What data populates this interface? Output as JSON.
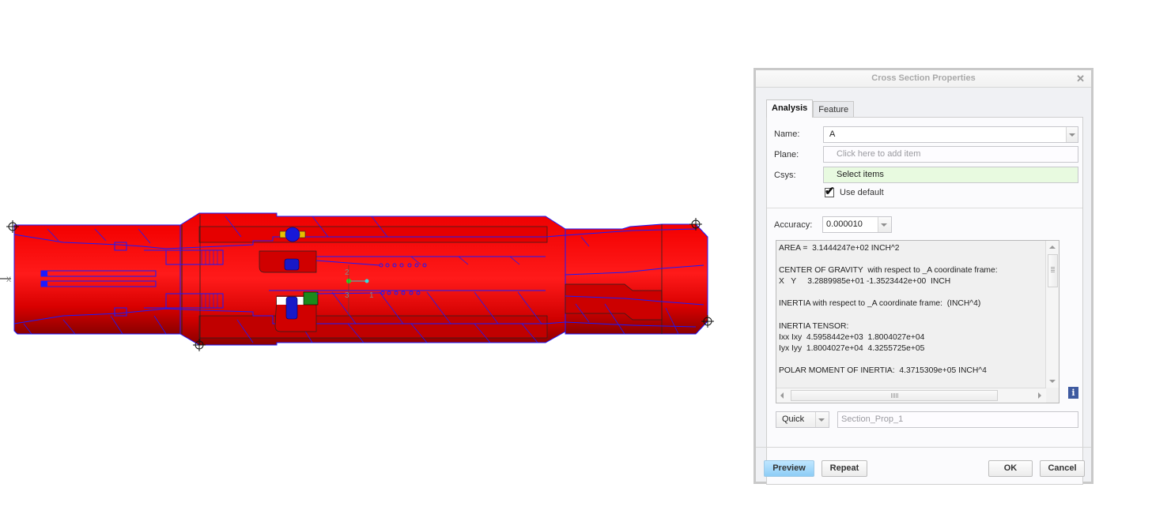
{
  "dialog": {
    "title": "Cross Section Properties",
    "close_icon": "close-icon",
    "tabs": [
      {
        "label": "Analysis",
        "active": true
      },
      {
        "label": "Feature",
        "active": false
      }
    ],
    "name": {
      "label": "Name:",
      "value": "A"
    },
    "plane": {
      "label": "Plane:",
      "placeholder": "Click here to add item"
    },
    "csys": {
      "label": "Csys:",
      "value": "Select items"
    },
    "use_default": {
      "label": "Use default",
      "checked": true
    },
    "accuracy": {
      "label": "Accuracy:",
      "value": "0.000010"
    },
    "results": {
      "lines": [
        "AREA =  3.1444247e+02 INCH^2",
        "",
        "CENTER OF GRAVITY  with respect to _A coordinate frame:",
        "X   Y     3.2889985e+01 -1.3523442e+00  INCH",
        "",
        "INERTIA with respect to _A coordinate frame:  (INCH^4)",
        "",
        "INERTIA TENSOR:",
        "Ixx Ixy  4.5958442e+03  1.8004027e+04",
        "Iyx Iyy  1.8004027e+04  4.3255725e+05",
        "",
        "POLAR MOMENT OF INERTIA:  4.3715309e+05 INCH^4"
      ]
    },
    "info_icon": "info-icon",
    "mode": {
      "value": "Quick"
    },
    "feature_name": {
      "placeholder": "Section_Prop_1"
    },
    "buttons": {
      "preview": "Preview",
      "repeat": "Repeat",
      "ok": "OK",
      "cancel": "Cancel"
    }
  },
  "model": {
    "body_color": "#ff1010",
    "edge_color": "#1a1aff",
    "shade_color": "#a80000",
    "csys_labels": [
      "X",
      "2",
      "3",
      "1"
    ]
  }
}
